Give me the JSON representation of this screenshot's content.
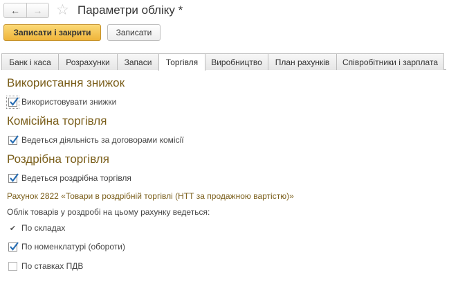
{
  "window": {
    "title": "Параметри обліку *",
    "back_icon": "arrow-left-icon",
    "forward_icon": "arrow-right-icon",
    "favorite_icon": "star-icon"
  },
  "toolbar": {
    "save_close_label": "Записати і закрити",
    "save_label": "Записати"
  },
  "tabs": [
    {
      "label": "Банк і каса"
    },
    {
      "label": "Розрахунки"
    },
    {
      "label": "Запаси"
    },
    {
      "label": "Торгівля"
    },
    {
      "label": "Виробництво"
    },
    {
      "label": "План рахунків"
    },
    {
      "label": "Співробітники і зарплата"
    }
  ],
  "active_tab": "Торгівля",
  "sections": {
    "discounts": {
      "title": "Використання знижок",
      "use_discounts": {
        "label": "Використовувати знижки",
        "checked": true
      }
    },
    "commission": {
      "title": "Комісійна торгівля",
      "commission_activity": {
        "label": "Ведеться діяльність за договорами комісії",
        "checked": true
      }
    },
    "retail": {
      "title": "Роздрібна торгівля",
      "retail_activity": {
        "label": "Ведеться роздрібна торгівля",
        "checked": true
      },
      "account_link": "Рахунок 2822 «Товари в роздрібній торгівлі (НТТ за продажною вартістю)»",
      "tracking_label": "Облік товарів у роздробі на цьому рахунку ведеться:",
      "by_warehouses": {
        "label": "По складах",
        "checked": true
      },
      "by_nomenclature": {
        "label": "По номенклатурі (обороти)",
        "checked": true
      },
      "by_vat_rates": {
        "label": "По ставках ПДВ",
        "checked": false
      }
    }
  },
  "colors": {
    "accent_heading": "#7a5e1a",
    "primary_button": "#f5c550",
    "checkmark": "#2a6fb4"
  }
}
